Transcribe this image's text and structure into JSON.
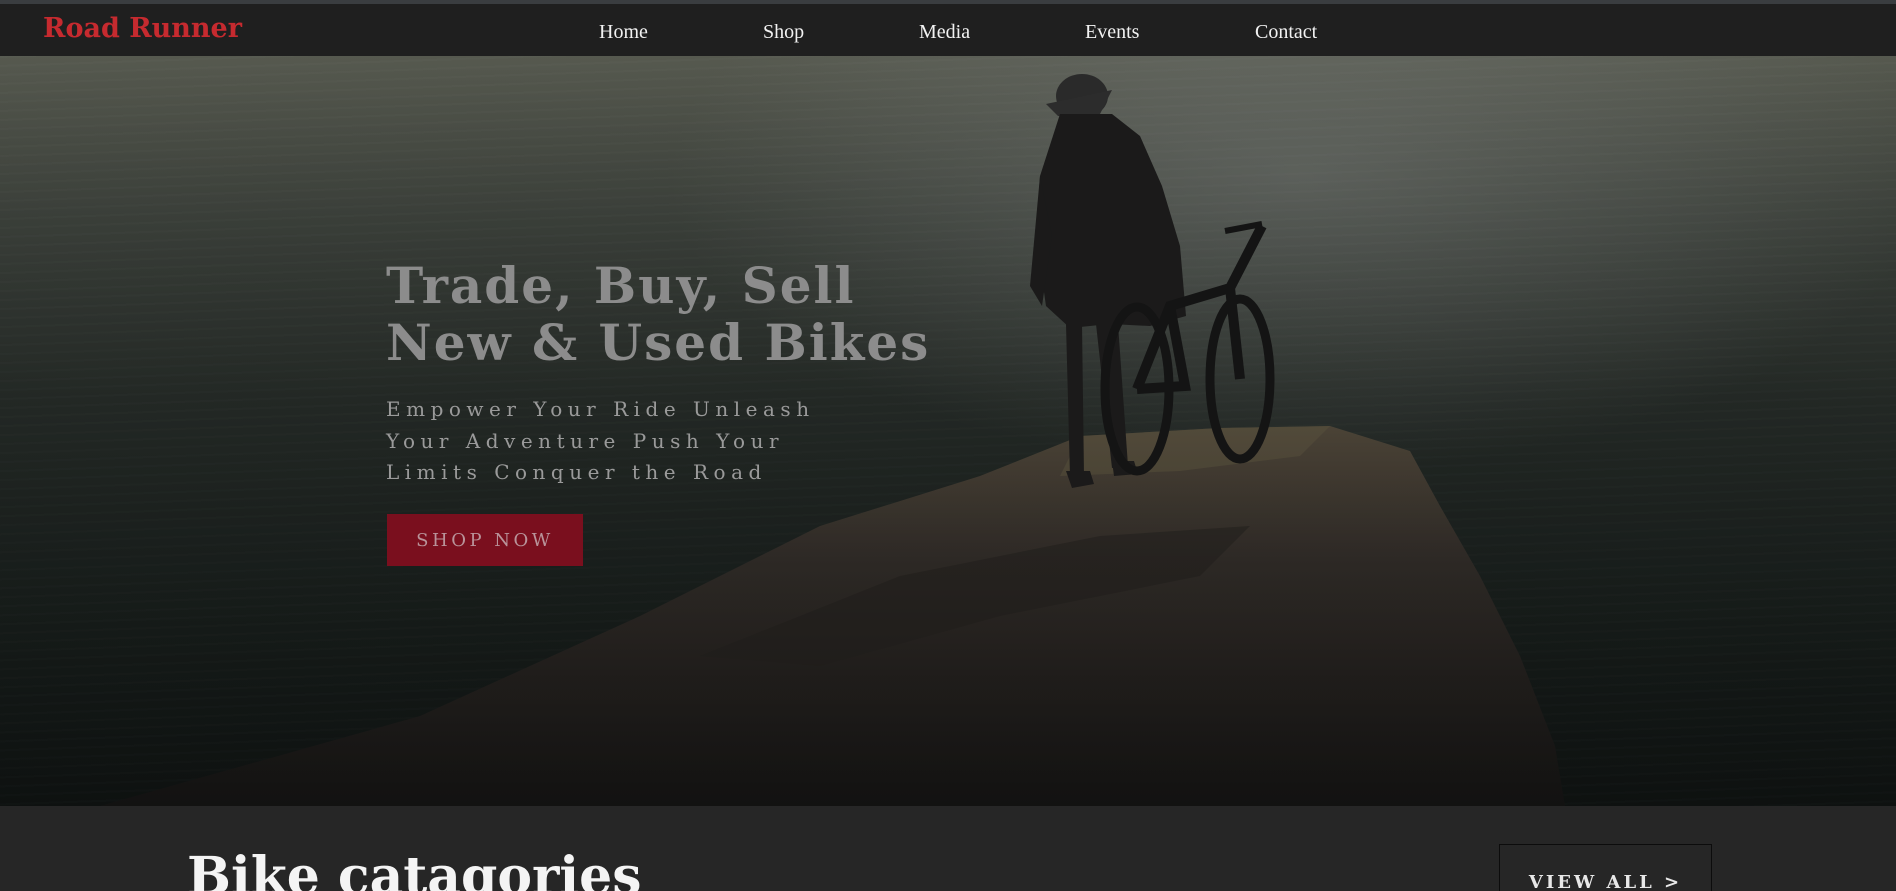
{
  "brand": {
    "name": "Road Runner",
    "color": "#c62a2f"
  },
  "nav": {
    "items": [
      {
        "label": "Home"
      },
      {
        "label": "Shop"
      },
      {
        "label": "Media"
      },
      {
        "label": "Events"
      },
      {
        "label": "Contact"
      }
    ]
  },
  "hero": {
    "title_line1": "Trade, Buy, Sell",
    "title_line2": "New & Used Bikes",
    "subtitle_line1": "Empower Your Ride Unleash",
    "subtitle_line2": "Your Adventure Push Your",
    "subtitle_line3": "Limits Conquer the Road",
    "cta_label": "SHOP NOW",
    "cta_color": "#7a0f1e"
  },
  "categories": {
    "title": "Bike catagories",
    "view_all_label": "VIEW ALL >"
  }
}
